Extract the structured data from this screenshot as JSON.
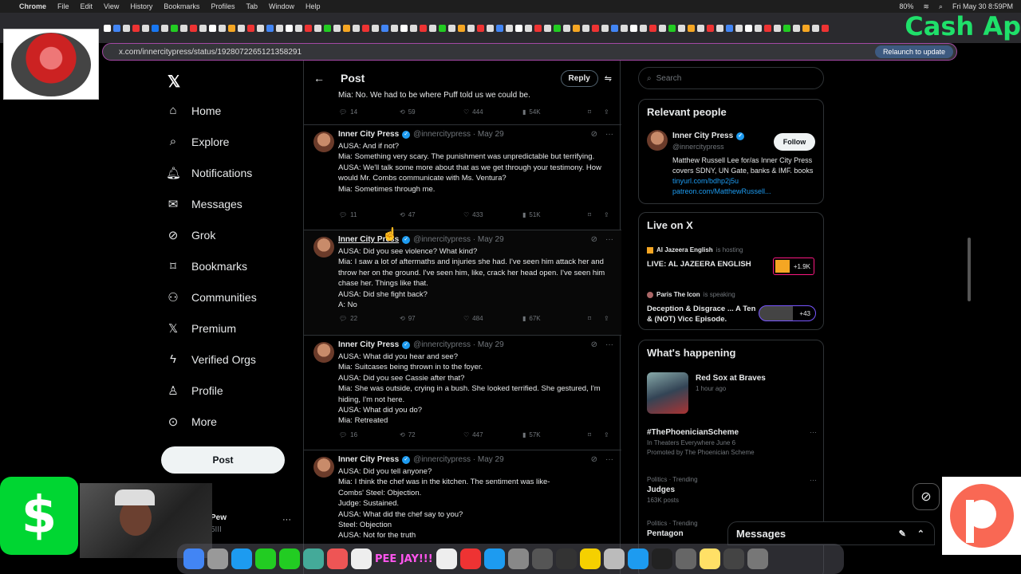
{
  "menubar": {
    "apple": "",
    "items": [
      "Chrome",
      "File",
      "Edit",
      "View",
      "History",
      "Bookmarks",
      "Profiles",
      "Tab",
      "Window",
      "Help"
    ],
    "battery": "80%",
    "clock": "Fri May 30  8:59PM"
  },
  "overlay_text": "Cash Ap",
  "browser": {
    "url": "x.com/innercitypress/status/1928072265121358291",
    "relaunch": "Relaunch to update"
  },
  "nav": {
    "items": [
      "Home",
      "Explore",
      "Notifications",
      "Messages",
      "Grok",
      "Bookmarks",
      "Communities",
      "Premium",
      "Verified Orgs",
      "Profile",
      "More"
    ],
    "post_label": "Post",
    "account_name": "Pew",
    "account_handle": "5III"
  },
  "feed": {
    "title": "Post",
    "reply_label": "Reply",
    "top_text": "Mia: No. We had to be where Puff told us we could be.",
    "top_stats": {
      "replies": "14",
      "reposts": "59",
      "likes": "444",
      "views": "54K"
    },
    "tweets": [
      {
        "name": "Inner City Press",
        "handle": "@innercitypress · May 29",
        "lines": [
          "AUSA: And if not?",
          "Mia: Something very scary. The punishment was unpredictable but terrifying.",
          "AUSA: We'll talk some more about that as we get through your testimony. How would Mr. Combs communicate with Ms. Ventura?",
          "Mia: Sometimes through me."
        ],
        "stats": {
          "replies": "11",
          "reposts": "47",
          "likes": "433",
          "views": "51K"
        }
      },
      {
        "name": "Inner City Press",
        "handle": "@innercitypress · May 29",
        "lines": [
          "AUSA: Did you see violence? What kind?",
          "Mia: I saw a lot of aftermaths and injuries she had. I've seen him attack her and throw her on the ground. I've seen him, like, crack her head open. I've seen him chase her. Things like that.",
          "AUSA: Did she fight back?",
          "A: No"
        ],
        "stats": {
          "replies": "22",
          "reposts": "97",
          "likes": "484",
          "views": "67K"
        }
      },
      {
        "name": "Inner City Press",
        "handle": "@innercitypress · May 29",
        "lines": [
          "AUSA: What did you hear and see?",
          "Mia: Suitcases being thrown in to the foyer.",
          "AUSA: Did you see Cassie after that?",
          "Mia: She was outside, crying in a bush. She looked terrified. She gestured, I'm hiding, I'm not here.",
          "AUSA: What did you do?",
          "Mia: Retreated"
        ],
        "stats": {
          "replies": "16",
          "reposts": "72",
          "likes": "447",
          "views": "57K"
        }
      },
      {
        "name": "Inner City Press",
        "handle": "@innercitypress · May 29",
        "lines": [
          "AUSA: Did you tell anyone?",
          "Mia: I think the chef was in the kitchen. The sentiment was like-",
          "Combs' Steel: Objection.",
          "Judge: Sustained.",
          "AUSA: What did the chef say to you?",
          "Steel: Objection",
          "AUSA: Not for the truth"
        ],
        "stats": {
          "replies": "",
          "reposts": "",
          "likes": "",
          "views": ""
        }
      }
    ]
  },
  "sidebar": {
    "search_placeholder": "Search",
    "relevant": {
      "title": "Relevant people",
      "name": "Inner City Press",
      "handle": "@innercitypress",
      "follow": "Follow",
      "bio": "Matthew Russell Lee for/as Inner City Press covers SDNY, UN Gate, banks & IMF. books ",
      "link1": "tinyurl.com/bdhp2j5u",
      "link2": "patreon.com/MatthewRussell..."
    },
    "live": {
      "title": "Live on X",
      "host1": "Al Jazeera English",
      "host1_status": "is hosting",
      "title1": "LIVE: AL JAZEERA ENGLISH",
      "count1": "+1.9K",
      "host2": "Paris The Icon",
      "host2_status": "is speaking",
      "title2": "Deception & Disgrace ... A Ten & (NOT) Vicc Episode.",
      "count2": "+43"
    },
    "happening": {
      "title": "What's happening",
      "t1": "Red Sox at Braves",
      "t1_sub": "1 hour ago",
      "t2_name": "#ThePhoenicianScheme",
      "t2_sub": "In Theaters Everywhere June 6",
      "t2_promo": "Promoted by The Phoenician Scheme",
      "t3_cat": "Politics · Trending",
      "t3_name": "Judges",
      "t3_posts": "163K posts",
      "t4_cat": "Politics · Trending",
      "t4_name": "Pentagon"
    }
  },
  "messages_drawer": "Messages",
  "dock_label": "PEE JAY!!!"
}
